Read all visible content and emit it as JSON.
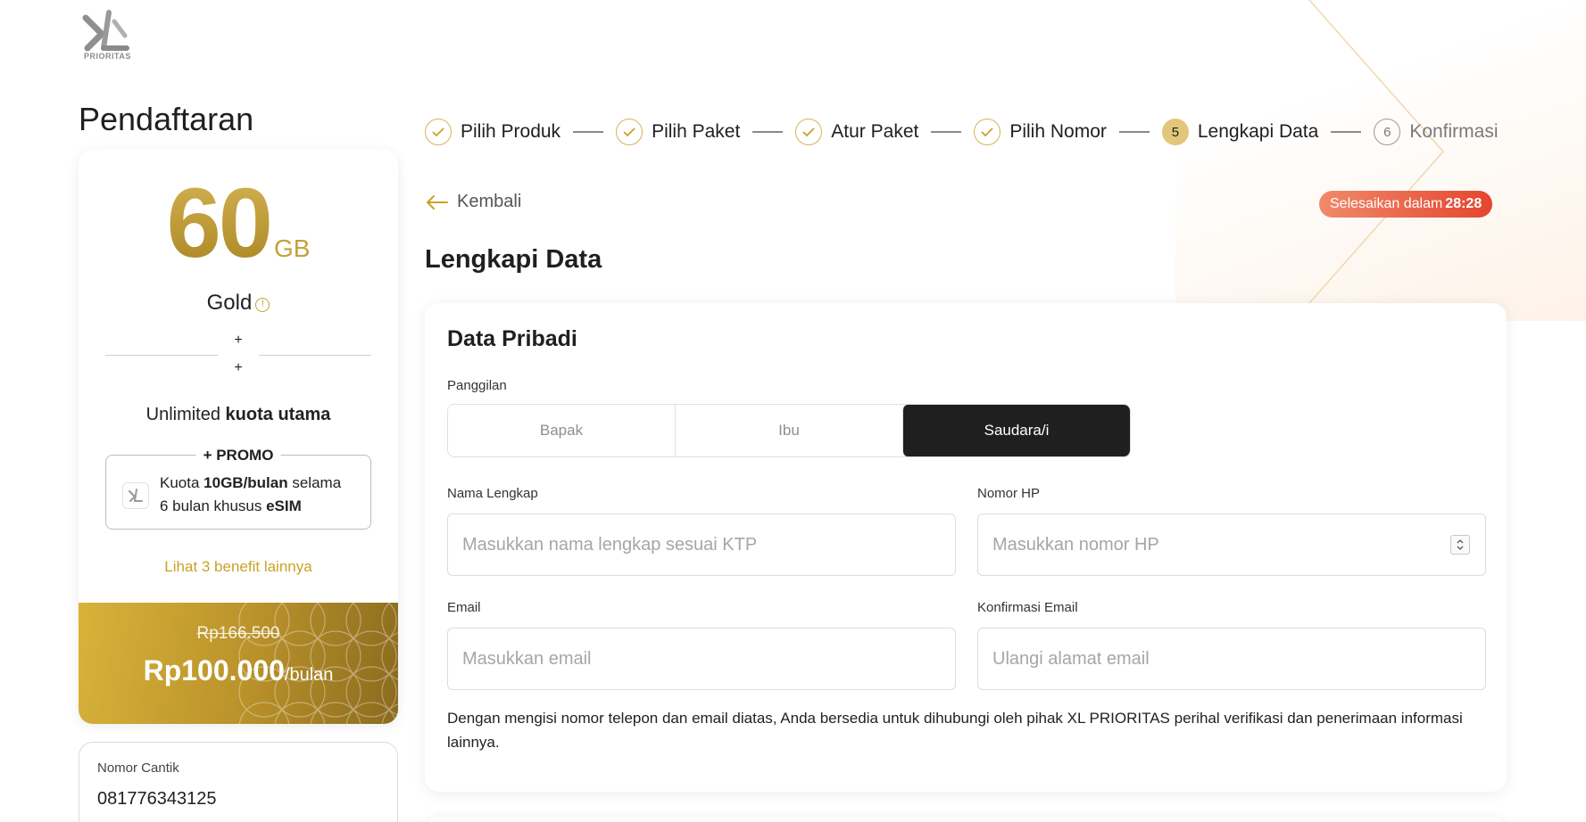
{
  "brand": {
    "logo_text": "PRIORITAS",
    "accent": "#c9a227",
    "gold_light": "#d6b354"
  },
  "page": {
    "title": "Pendaftaran"
  },
  "plan": {
    "quota_value": "60",
    "quota_unit": "GB",
    "name": "Gold",
    "plus_1": "+",
    "plus_2": "+",
    "unlimited_prefix": "Unlimited",
    "unlimited_bold": "kuota utama",
    "promo_title": "+ PROMO",
    "promo_line1_a": "Kuota ",
    "promo_line1_b": "10GB/bulan",
    "promo_line1_c": " selama",
    "promo_line2_a": "6 bulan khusus ",
    "promo_line2_b": "eSIM",
    "benefit_link": "Lihat 3 benefit lainnya",
    "old_price": "Rp166.500",
    "new_price": "Rp100.000",
    "price_period": "/bulan"
  },
  "number_card": {
    "label": "Nomor Cantik",
    "value": "081776343125"
  },
  "stepper": {
    "steps": [
      {
        "label": "Pilih Produk",
        "state": "done"
      },
      {
        "label": "Pilih Paket",
        "state": "done"
      },
      {
        "label": "Atur Paket",
        "state": "done"
      },
      {
        "label": "Pilih Nomor",
        "state": "done"
      },
      {
        "label": "Lengkapi Data",
        "state": "active",
        "number": "5"
      },
      {
        "label": "Konfirmasi",
        "state": "pending",
        "number": "6"
      }
    ]
  },
  "back": {
    "label": "Kembali"
  },
  "timer": {
    "text": "Selesaikan dalam",
    "time": "28:28",
    "color_start": "#f08a6a",
    "color_end": "#e5452f"
  },
  "section": {
    "title": "Lengkapi Data"
  },
  "form": {
    "card_title": "Data Pribadi",
    "salutation_label": "Panggilan",
    "salutation_options": [
      "Bapak",
      "Ibu",
      "Saudara/i"
    ],
    "salutation_selected": "Saudara/i",
    "full_name_label": "Nama Lengkap",
    "full_name_placeholder": "Masukkan nama lengkap sesuai KTP",
    "full_name_value": "",
    "phone_label": "Nomor HP",
    "phone_placeholder": "Masukkan nomor HP",
    "phone_value": "",
    "email_label": "Email",
    "email_placeholder": "Masukkan email",
    "email_value": "",
    "confirm_email_label": "Konfirmasi Email",
    "confirm_email_placeholder": "Ulangi alamat email",
    "confirm_email_value": "",
    "consent_text": "Dengan mengisi nomor telepon dan email diatas, Anda bersedia untuk dihubungi oleh pihak XL PRIORITAS perihal verifikasi dan penerimaan informasi lainnya."
  }
}
